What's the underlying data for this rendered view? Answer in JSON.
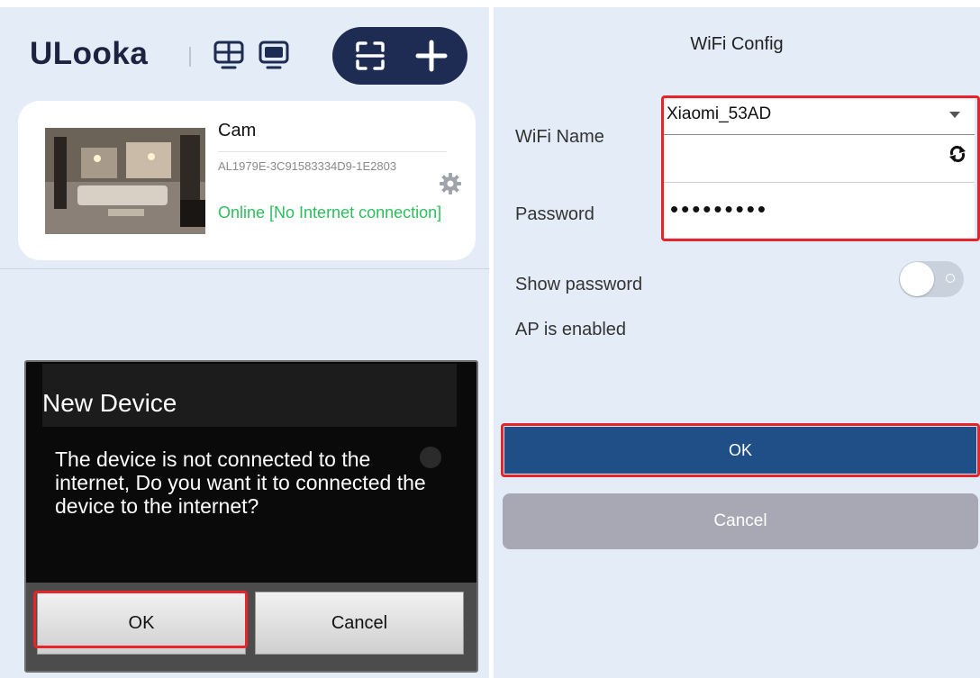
{
  "left": {
    "app_title": "ULooka",
    "header_icons": [
      "grid-view-icon",
      "monitor-icon",
      "scan-icon",
      "add-icon"
    ],
    "device_card": {
      "name": "Cam",
      "device_id": "AL1979E-3C91583334D9-1E2803",
      "status": "Online [No Internet connection]",
      "status_color": "#2cbf5b"
    },
    "dialog": {
      "title": "New Device",
      "message": "The device is not connected to the internet, Do you want it to connected the device to the internet?",
      "ok_label": "OK",
      "cancel_label": "Cancel"
    }
  },
  "right": {
    "title": "WiFi Config",
    "wifi_name_label": "WiFi Name",
    "wifi_name_value": "Xiaomi_53AD",
    "password_label": "Password",
    "password_value": "•••••••••",
    "show_password_label": "Show password",
    "show_password_on": false,
    "ap_status": "AP is enabled",
    "ok_label": "OK",
    "cancel_label": "Cancel"
  },
  "colors": {
    "background": "#e3ecf7",
    "pill": "#1e2b52",
    "primary_button": "#1f4f86",
    "secondary_button": "#a7a8b4",
    "highlight": "#e8232a"
  }
}
